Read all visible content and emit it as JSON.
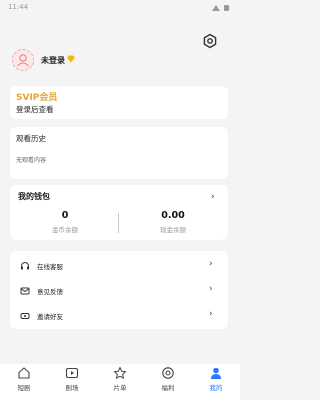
{
  "status_bar": {
    "time": "11:44"
  },
  "profile": {
    "login_text": "未登录"
  },
  "svip": {
    "title": "SVIP会员",
    "subtitle": "登录后查看"
  },
  "history": {
    "title": "观看历史",
    "empty_text": "无观看内容"
  },
  "wallet": {
    "title": "我的钱包",
    "coins": {
      "value": "0",
      "label": "金币余额"
    },
    "cash": {
      "value": "0.00",
      "label": "现金余额"
    }
  },
  "menu": [
    {
      "label": "在线客服",
      "icon": "headset-icon"
    },
    {
      "label": "意见反馈",
      "icon": "feedback-mail-icon"
    },
    {
      "label": "邀请好友",
      "icon": "invite-ticket-icon"
    }
  ],
  "nav": [
    {
      "label": "短剧",
      "icon": "home-icon"
    },
    {
      "label": "剧场",
      "icon": "play-screen-icon"
    },
    {
      "label": "片单",
      "icon": "star-icon"
    },
    {
      "label": "福利",
      "icon": "gift-target-icon"
    },
    {
      "label": "我的",
      "icon": "user-icon"
    }
  ],
  "colors": {
    "accent": "#2979ff",
    "svip": "#e8a531",
    "diamond": "#f5b800"
  }
}
